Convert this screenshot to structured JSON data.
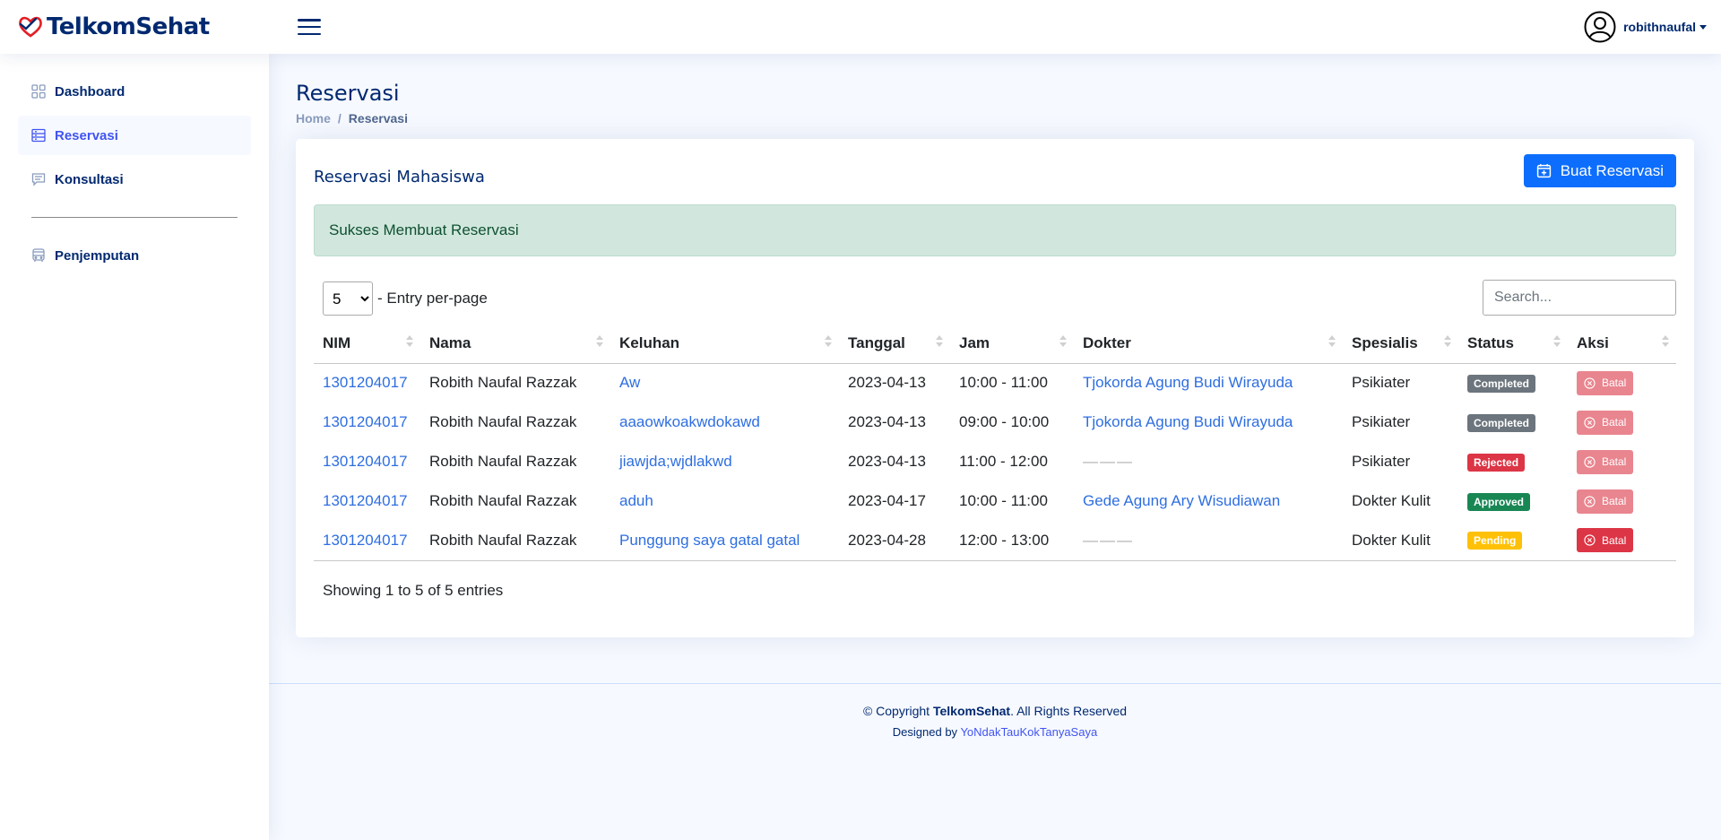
{
  "brand": {
    "name": "TelkomSehat",
    "accent": "#4154f1",
    "primary": "#012970"
  },
  "header": {
    "username": "robithnaufal"
  },
  "sidebar": {
    "items": [
      {
        "label": "Dashboard",
        "icon": "grid-icon"
      },
      {
        "label": "Reservasi",
        "icon": "list-icon",
        "active": true
      },
      {
        "label": "Konsultasi",
        "icon": "chat-icon"
      },
      {
        "label": "Penjemputan",
        "icon": "bus-icon"
      }
    ]
  },
  "page": {
    "title": "Reservasi",
    "breadcrumb": {
      "home": "Home",
      "sep": "/",
      "current": "Reservasi"
    }
  },
  "card": {
    "title": "Reservasi Mahasiswa",
    "create_button": "Buat Reservasi",
    "alert": "Sukses Membuat Reservasi"
  },
  "datatable": {
    "per_page_value": "5",
    "per_page_label": "- Entry per-page",
    "search_placeholder": "Search...",
    "columns": [
      "NIM",
      "Nama",
      "Keluhan",
      "Tanggal",
      "Jam",
      "Dokter",
      "Spesialis",
      "Status",
      "Aksi"
    ],
    "rows": [
      {
        "nim": "1301204017",
        "nama": "Robith Naufal Razzak",
        "keluhan": "Aw",
        "tanggal": "2023-04-13",
        "jam": "10:00 - 11:00",
        "dokter": "Tjokorda Agung Budi Wirayuda",
        "spesialis": "Psikiater",
        "status": "Completed",
        "aksi": "Batal"
      },
      {
        "nim": "1301204017",
        "nama": "Robith Naufal Razzak",
        "keluhan": "aaaowkoakwdokawd",
        "tanggal": "2023-04-13",
        "jam": "09:00 - 10:00",
        "dokter": "Tjokorda Agung Budi Wirayuda",
        "spesialis": "Psikiater",
        "status": "Completed",
        "aksi": "Batal"
      },
      {
        "nim": "1301204017",
        "nama": "Robith Naufal Razzak",
        "keluhan": "jiawjda;wjdlakwd",
        "tanggal": "2023-04-13",
        "jam": "11:00 - 12:00",
        "dokter": "———",
        "spesialis": "Psikiater",
        "status": "Rejected",
        "aksi": "Batal"
      },
      {
        "nim": "1301204017",
        "nama": "Robith Naufal Razzak",
        "keluhan": "aduh",
        "tanggal": "2023-04-17",
        "jam": "10:00 - 11:00",
        "dokter": "Gede Agung Ary Wisudiawan",
        "spesialis": "Dokter Kulit",
        "status": "Approved",
        "aksi": "Batal"
      },
      {
        "nim": "1301204017",
        "nama": "Robith Naufal Razzak",
        "keluhan": "Punggung saya gatal gatal",
        "tanggal": "2023-04-28",
        "jam": "12:00 - 13:00",
        "dokter": "———",
        "spesialis": "Dokter Kulit",
        "status": "Pending",
        "aksi": "Batal"
      }
    ],
    "info": "Showing 1 to 5 of 5 entries"
  },
  "footer": {
    "copyright_prefix": "© Copyright",
    "copyright_brand": "TelkomSehat",
    "copyright_suffix": ". All Rights Reserved",
    "designed_by": "Designed by",
    "designer": "YoNdakTauKokTanyaSaya"
  }
}
